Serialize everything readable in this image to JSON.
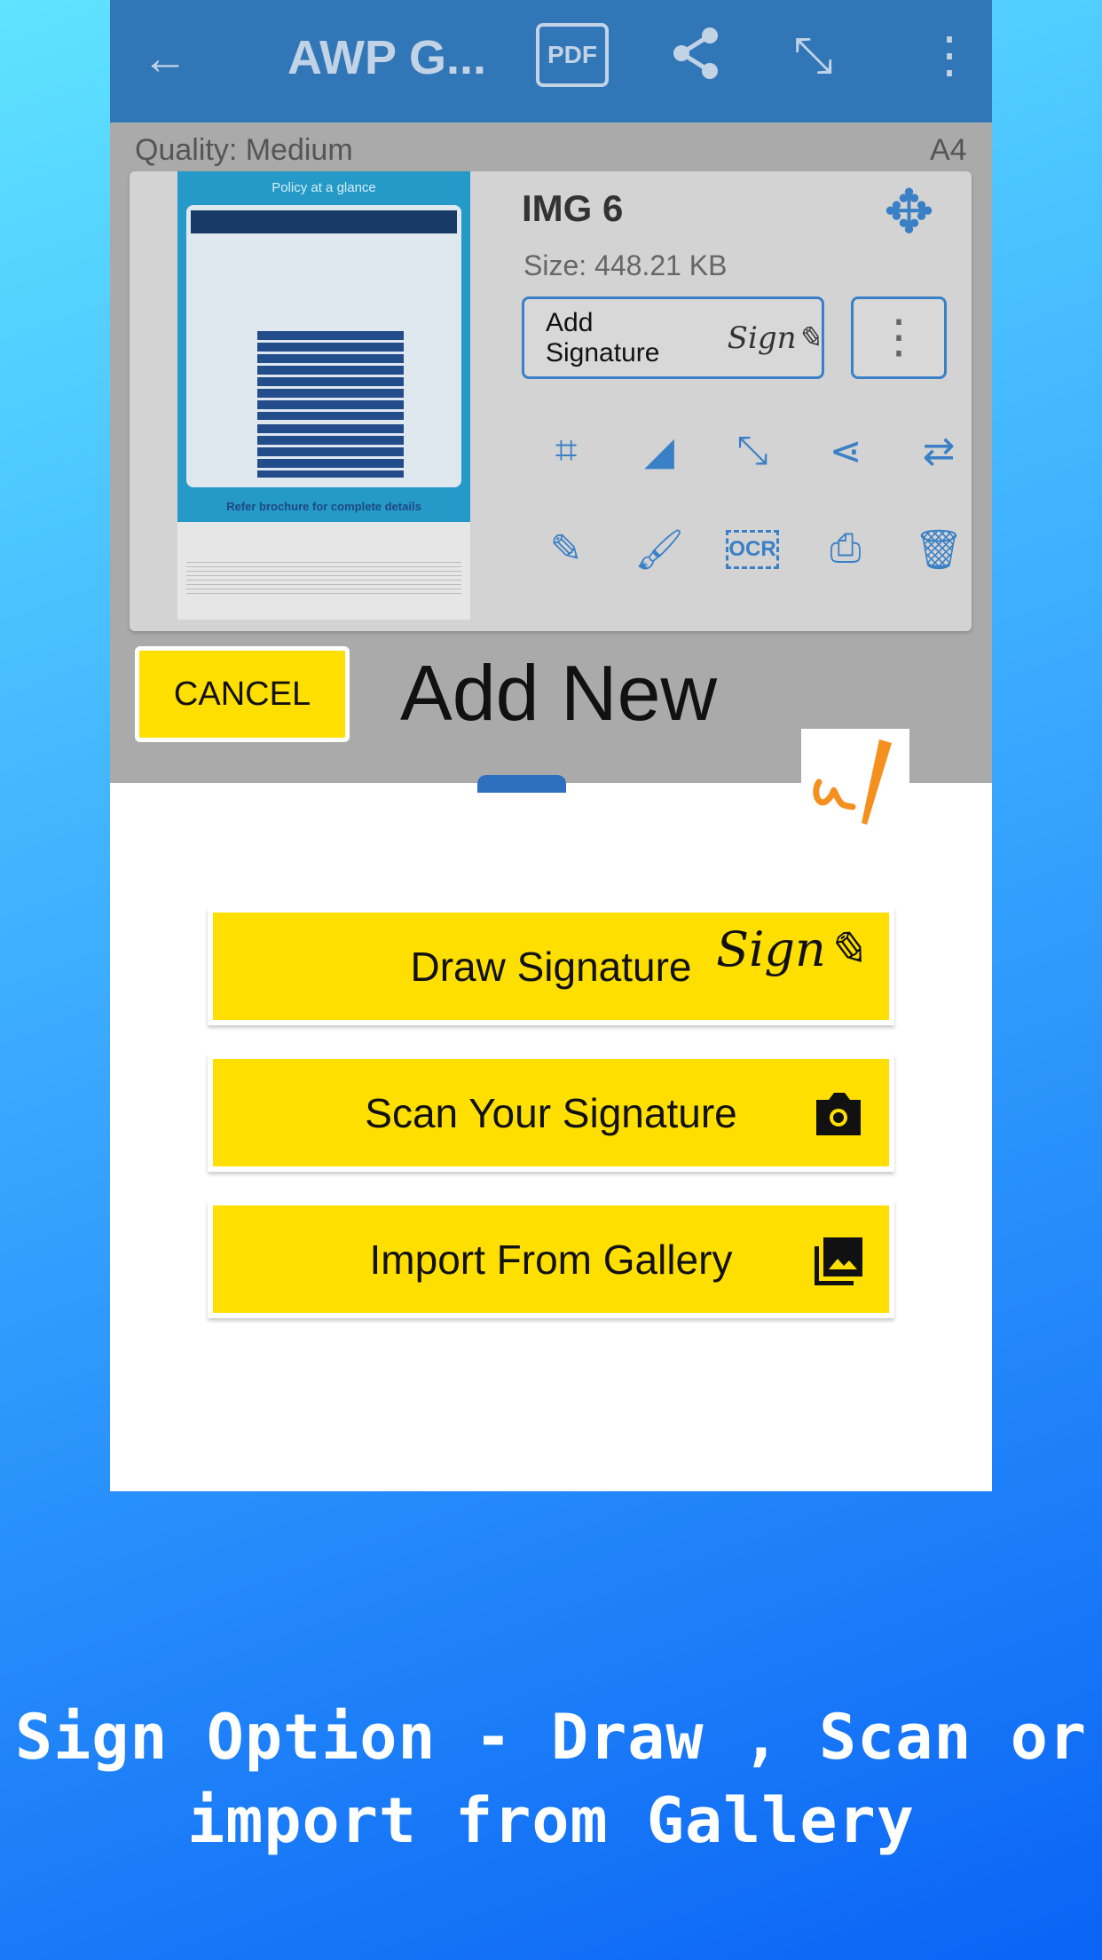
{
  "topbar": {
    "title": "AWP G...",
    "icons": [
      "back-arrow-icon",
      "pdf-icon",
      "share-icon",
      "compress-icon",
      "more-vert-icon"
    ]
  },
  "doc": {
    "quality": "Quality: Medium",
    "page_size": "A4",
    "name": "IMG 6",
    "size": "Size: 448.21 KB",
    "add_signature": "Add Signature",
    "thumb_title": "Policy at a glance",
    "thumb_footer": "Refer brochure for complete details",
    "tools": [
      "crop-icon",
      "eraser-icon",
      "compress-icon",
      "share-icon",
      "swap-icon",
      "edit-note-icon",
      "brush-icon",
      "ocr-icon",
      "print-icon",
      "delete-icon"
    ],
    "ocr_label": "OCR"
  },
  "dialog": {
    "cancel": "CANCEL",
    "title": "Add New",
    "options": [
      {
        "label": "Draw Signature",
        "icon": "sign-pen-icon"
      },
      {
        "label": "Scan Your Signature",
        "icon": "camera-icon"
      },
      {
        "label": "Import From Gallery",
        "icon": "gallery-icon"
      }
    ]
  },
  "caption": {
    "line1": "Sign Option - Draw , Scan or",
    "line2": "import from Gallery"
  },
  "colors": {
    "accent_yellow": "#ffdf00",
    "bar_blue": "#3177b8",
    "sign_orange": "#f5901e"
  }
}
